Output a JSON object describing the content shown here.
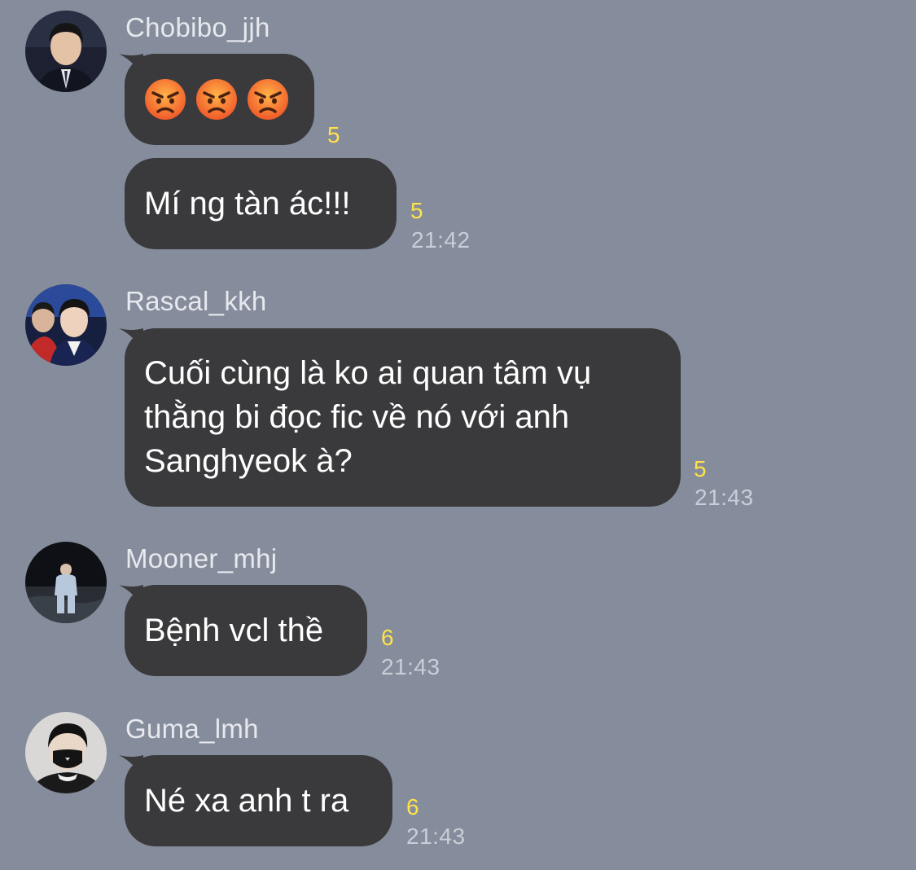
{
  "colors": {
    "background": "#858c9b",
    "bubble": "#3a3a3c",
    "bubble_text": "#ffffff",
    "sender_name": "#e6e9ee",
    "read_count": "#ffe24a",
    "time": "#c9ced8"
  },
  "messages": [
    {
      "sender": "Chobibo_jjh",
      "avatar_icon": "profile-photo",
      "bubbles": [
        {
          "type": "emoji",
          "emojis": [
            "angry-face-emoji",
            "angry-face-emoji",
            "angry-face-emoji"
          ],
          "read_count": "5"
        },
        {
          "type": "text",
          "lines": [
            "Mí ng tàn ác!!!"
          ],
          "read_count": "5",
          "time": "21:42"
        }
      ]
    },
    {
      "sender": "Rascal_kkh",
      "avatar_icon": "profile-photo",
      "bubbles": [
        {
          "type": "text",
          "lines": [
            "Cuối cùng là ko ai quan tâm vụ",
            "thằng bi đọc fic về nó với anh",
            "Sanghyeok à?"
          ],
          "read_count": "5",
          "time": "21:43"
        }
      ]
    },
    {
      "sender": "Mooner_mhj",
      "avatar_icon": "profile-photo",
      "bubbles": [
        {
          "type": "text",
          "lines": [
            "Bệnh vcl thề"
          ],
          "read_count": "6",
          "time": "21:43"
        }
      ]
    },
    {
      "sender": "Guma_lmh",
      "avatar_icon": "profile-photo",
      "bubbles": [
        {
          "type": "text",
          "lines": [
            "Né xa anh t ra"
          ],
          "read_count": "6",
          "time": "21:43"
        }
      ]
    }
  ]
}
